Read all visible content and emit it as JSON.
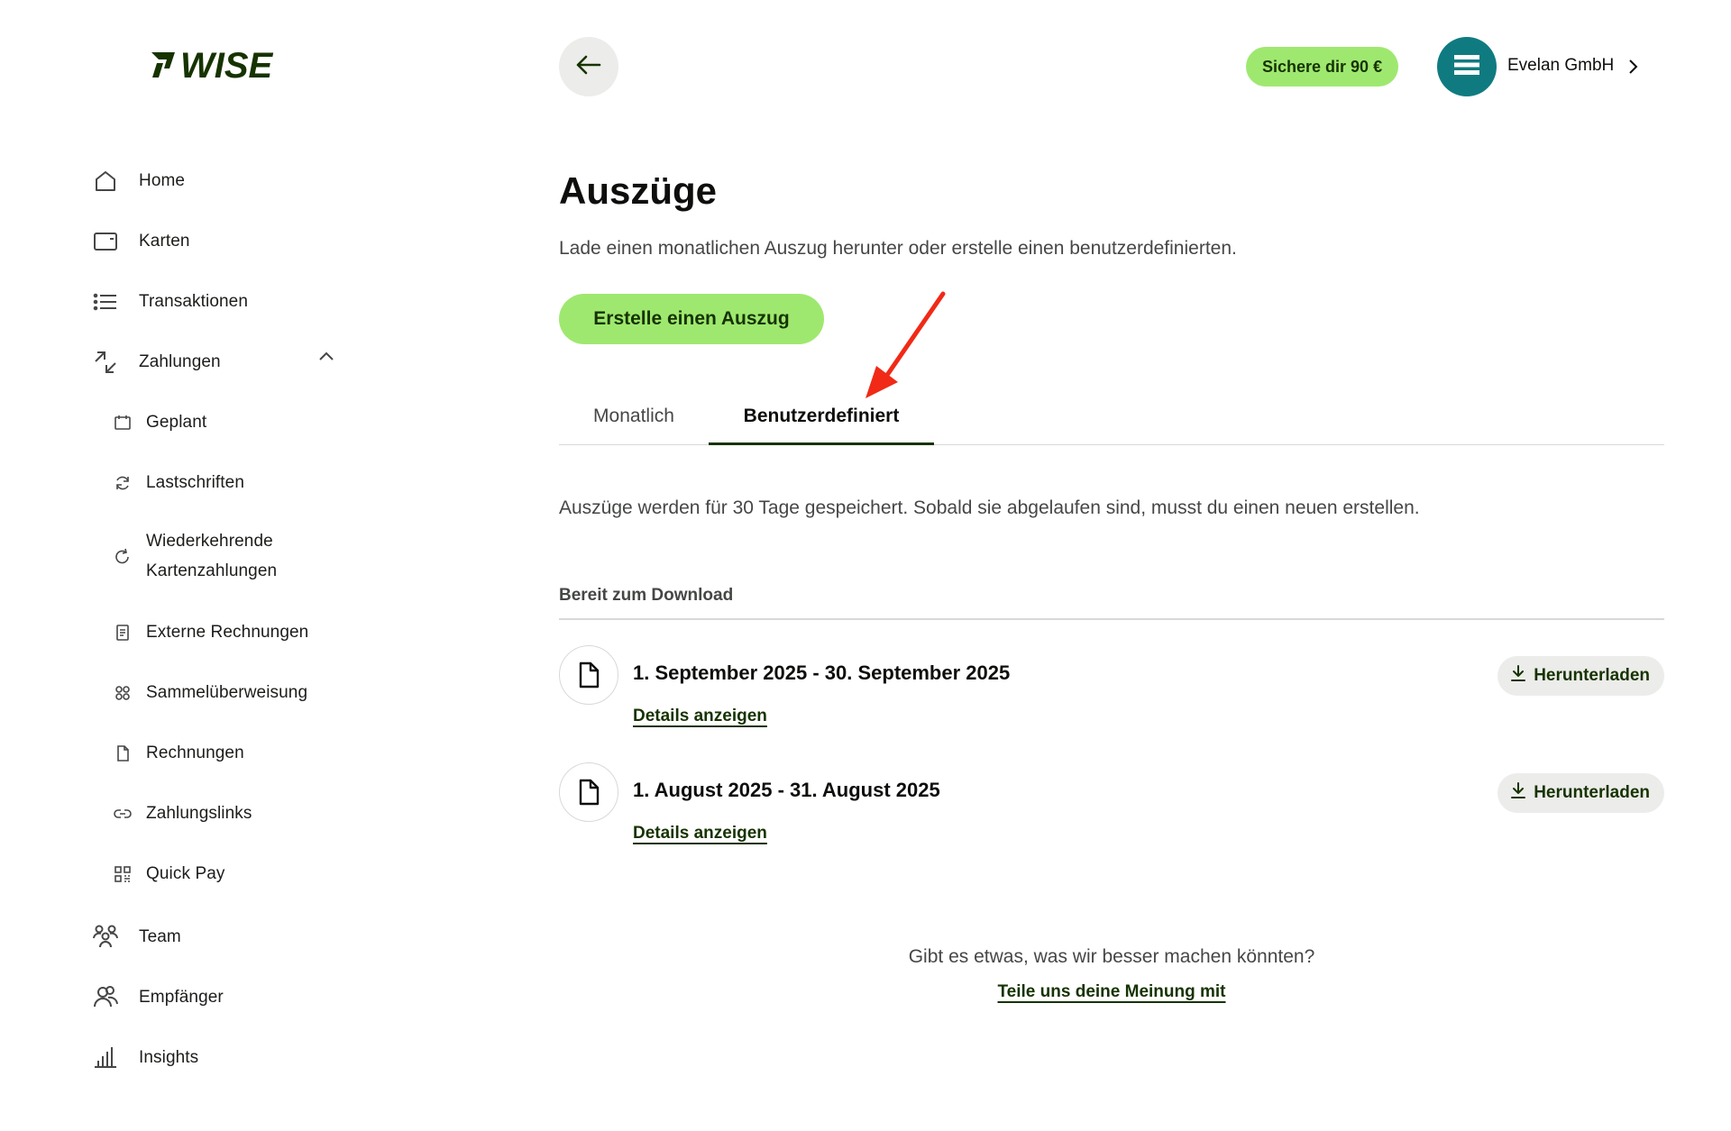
{
  "brand": {
    "logo_text": "WISE",
    "color": "#163300"
  },
  "sidebar": {
    "items": [
      {
        "label": "Home",
        "icon": "home-icon"
      },
      {
        "label": "Karten",
        "icon": "card-icon"
      },
      {
        "label": "Transaktionen",
        "icon": "list-icon"
      },
      {
        "label": "Zahlungen",
        "icon": "transfer-icon",
        "expanded": true
      },
      {
        "label": "Team",
        "icon": "team-icon"
      },
      {
        "label": "Empfänger",
        "icon": "recipients-icon"
      },
      {
        "label": "Insights",
        "icon": "chart-icon"
      }
    ],
    "sub_items": [
      {
        "label": "Geplant",
        "icon": "calendar-icon"
      },
      {
        "label": "Lastschriften",
        "icon": "refresh-icon"
      },
      {
        "label": "Wiederkehrende",
        "label2": "Kartenzahlungen",
        "icon": "recurring-icon"
      },
      {
        "label": "Externe Rechnungen",
        "icon": "receipt-icon"
      },
      {
        "label": "Sammelüberweisung",
        "icon": "batch-icon"
      },
      {
        "label": "Rechnungen",
        "icon": "document-icon"
      },
      {
        "label": "Zahlungslinks",
        "icon": "link-icon"
      },
      {
        "label": "Quick Pay",
        "icon": "qr-icon"
      }
    ]
  },
  "header": {
    "promo_label": "Sichere dir 90 €",
    "account_name": "Evelan GmbH",
    "accent_color": "#9fe870",
    "avatar_color": "#0f7b80"
  },
  "main": {
    "title": "Auszüge",
    "subtitle": "Lade einen monatlichen Auszug herunter oder erstelle einen benutzerdefinierten.",
    "create_button": "Erstelle einen Auszug",
    "tabs": [
      {
        "label": "Monatlich",
        "active": false
      },
      {
        "label": "Benutzerdefiniert",
        "active": true
      }
    ],
    "info": "Auszüge werden für 30 Tage gespeichert. Sobald sie abgelaufen sind, musst du einen neuen erstellen.",
    "section_label": "Bereit zum Download",
    "statements": [
      {
        "period": "1. September 2025 - 30. September 2025",
        "details": "Details anzeigen",
        "download": "Herunterladen"
      },
      {
        "period": "1. August 2025 - 31. August 2025",
        "details": "Details anzeigen",
        "download": "Herunterladen"
      }
    ],
    "feedback_question": "Gibt es etwas, was wir besser machen könnten?",
    "feedback_link": "Teile uns deine Meinung mit"
  },
  "annotation": {
    "color": "#f02a16"
  }
}
